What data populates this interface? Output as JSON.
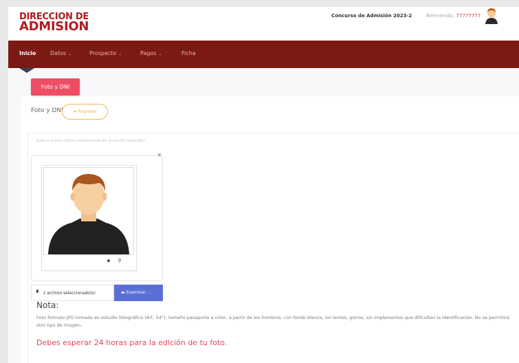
{
  "header": {
    "logo_line1": "DIRECCION DE",
    "logo_line2": "ADMISION",
    "concurso": "Concurso de Admisión 2023-2",
    "welcome_prefix": "Bienvenido,",
    "user_code": "77777777"
  },
  "nav": {
    "items": [
      {
        "label": "Inicio",
        "chevron": ""
      },
      {
        "label": "Datos",
        "chevron": "⌄"
      },
      {
        "label": "Prospecto",
        "chevron": "⌄"
      },
      {
        "label": "Pagos",
        "chevron": "⌄"
      },
      {
        "label": "Ficha",
        "chevron": ""
      }
    ]
  },
  "page": {
    "tab_label": "Foto y DNI",
    "section_label": "Foto y DNI",
    "regresar_label": "Regresar",
    "hint": "Suba el archivo digital proporcionado por el estudio fotográfico"
  },
  "upload": {
    "close_glyph": "×",
    "caption": "1 archivo seleccionado(s)",
    "browse_label": "Examinar ..."
  },
  "nota": {
    "title": "Nota:",
    "text": "Foto formato JPG tomada en estudio fotográfico (Art. 54°), tamaño pasaporte a color, a partir de los hombros, con fondo blanco, sin lentes, gorros, sin implementos que dificulten la identificación. No se permitirá otro tipo de imagen.",
    "warning": "Debes esperar 24 horas para la edición de tu foto."
  },
  "icons": {
    "trash": "trash-icon",
    "zoom": "zoom-icon",
    "file": "file-icon",
    "folder": "folder-icon",
    "back": "back-arrow-icon"
  },
  "colors": {
    "brand_red": "#b01b1f",
    "nav_bg": "#7a1a13",
    "pill": "#ee4e65",
    "browse": "#5a6fd6",
    "regresar": "#f0b84a",
    "warning": "#e0475b"
  }
}
